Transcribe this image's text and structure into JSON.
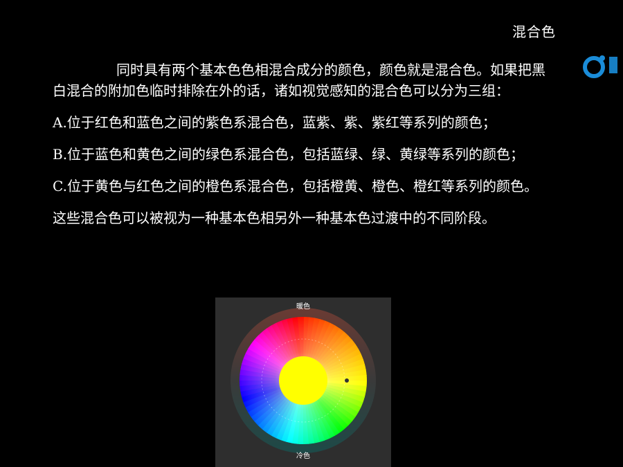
{
  "slide": {
    "title": "混合色"
  },
  "logo": {
    "icon": "blue-ring-logo-icon",
    "color": "#1a8cd8"
  },
  "content": {
    "intro": "同时具有两个基本色色相混合成分的颜色，颜色就是混合色。如果把黑白混合的附加色临时排除在外的话，诸如视觉感知的混合色可以分为三组：",
    "items": [
      "A.位于红色和蓝色之间的紫色系混合色，蓝紫、紫、紫红等系列的颜色；",
      "B.位于蓝色和黄色之间的绿色系混合色，包括蓝绿、绿、黄绿等系列的颜色；",
      "C.位于黄色与红色之间的橙色系混合色，包括橙黄、橙色、橙红等系列的颜色。"
    ],
    "conclusion": "这些混合色可以被视为一种基本色相另外一种基本色过渡中的不同阶段。"
  },
  "color_wheel": {
    "warm_label": "暖色",
    "cool_label": "冷色",
    "panel_color": "#2e2e2e",
    "center_color": "#ffff00"
  }
}
